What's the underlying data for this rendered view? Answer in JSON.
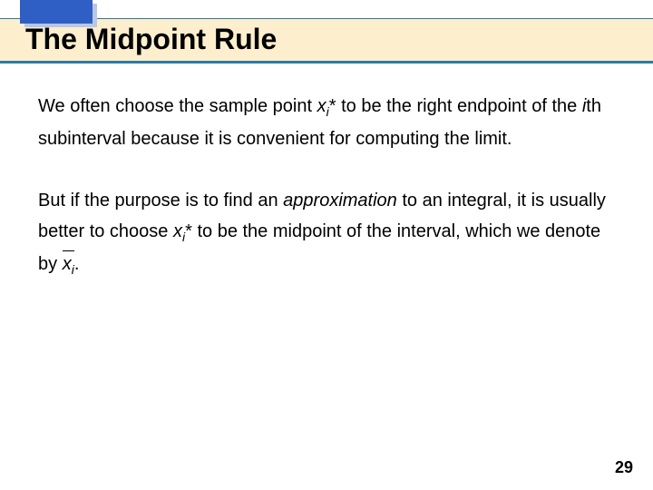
{
  "title": "The Midpoint Rule",
  "p1": {
    "t1": "We often choose the sample point ",
    "xi_var": "x",
    "xi_sub": "i",
    "xi_star": "*",
    "t2": " to be the right endpoint of the ",
    "ith_i": "i",
    "ith_rest": "th subinterval because it is convenient for computing the limit."
  },
  "p2": {
    "t1": "But if the purpose is to find an ",
    "approx": "approximation",
    "t2": " to an integral, it is usually better to choose ",
    "xi_var": "x",
    "xi_sub": "i",
    "xi_star": "*",
    "t3": " to be the midpoint of the interval, which we denote by ",
    "xbar_var": "x",
    "xbar_sub": "i",
    "period": "."
  },
  "page_number": "29"
}
